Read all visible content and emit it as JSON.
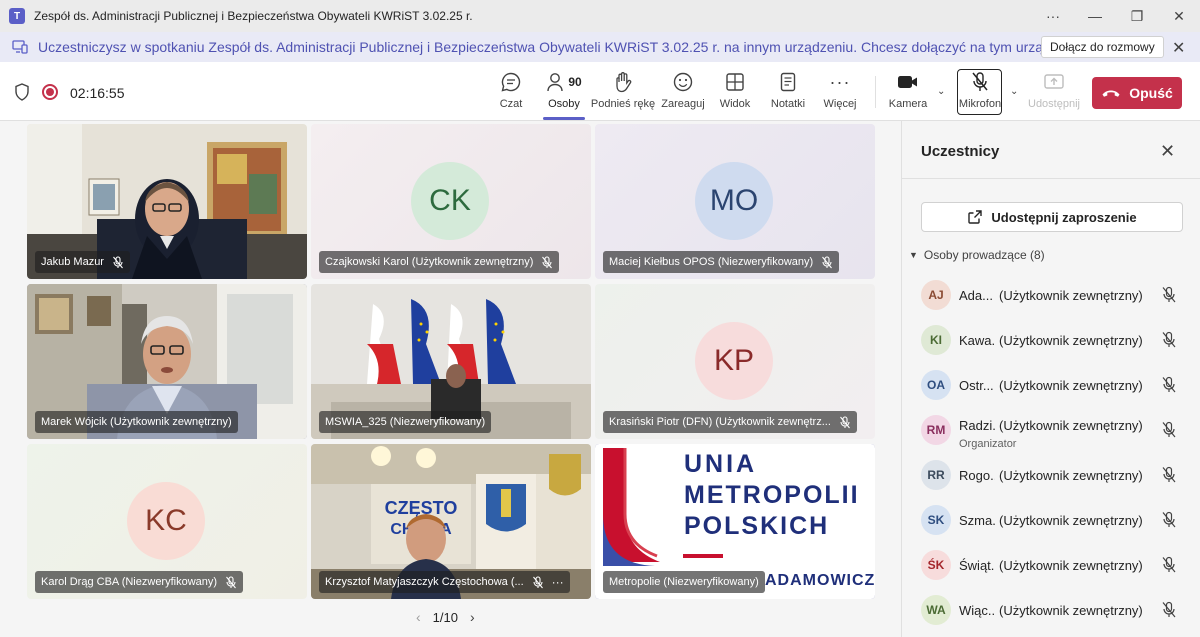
{
  "window": {
    "title": "Zespół ds. Administracji Publicznej i Bezpieczeństwa Obywateli KWRiST 3.02.25 r.",
    "controls": [
      "···",
      "✕",
      "☐",
      "✕"
    ]
  },
  "banner": {
    "message": "Uczestniczysz w spotkaniu Zespół ds. Administracji Publicznej i Bezpieczeństwa Obywateli KWRiST 3.02.25 r. na innym urządzeniu. Chcesz dołączyć na tym urządzeniu?",
    "join_label": "Dołącz do rozmowy"
  },
  "toolbar": {
    "timer": "02:16:55",
    "participants_count": "90",
    "items": {
      "chat": "Czat",
      "people": "Osoby",
      "raise_hand": "Podnieś rękę",
      "react": "Zareaguj",
      "view": "Widok",
      "notes": "Notatki",
      "more": "Więcej",
      "camera": "Kamera",
      "mic": "Mikrofon",
      "share": "Udostępnij"
    },
    "leave_label": "Opuść"
  },
  "tiles": [
    {
      "name": "Jakub Mazur",
      "type": "video"
    },
    {
      "name": "Czajkowski Karol (Użytkownik zewnętrzny)",
      "initials": "CK"
    },
    {
      "name": "Maciej Kiełbus OPOS (Niezweryfikowany)",
      "initials": "MO"
    },
    {
      "name": "Marek Wójcik (Użytkownik zewnętrzny)",
      "type": "video"
    },
    {
      "name": "MSWIA_325 (Niezweryfikowany)",
      "type": "video"
    },
    {
      "name": "Krasiński Piotr (DFN) (Użytkownik zewnętrz...",
      "initials": "KP"
    },
    {
      "name": "Karol Drąg CBA (Niezweryfikowany)",
      "initials": "KC"
    },
    {
      "name": "Krzysztof Matyjaszczyk Częstochowa (...",
      "type": "video"
    },
    {
      "name": "Metropolie (Niezweryfikowany)",
      "type": "video"
    }
  ],
  "metropolie_logo": {
    "line1": "UNIA",
    "line2": "METROPOLII",
    "line3": "POLSKICH",
    "bottom": "ADAMOWICZA"
  },
  "czestochowa_banner": "CZĘSTO\nCHOWA",
  "pager": "1/10",
  "panel": {
    "title": "Uczestnicy",
    "share_label": "Udostępnij zaproszenie",
    "section": "Osoby prowadzące (8)",
    "people": [
      {
        "initials": "AJ",
        "name": "Ada...",
        "ext": "(Użytkownik zewnętrzny)",
        "color": "#f2dcd4",
        "text_color": "#8a4b34"
      },
      {
        "initials": "KI",
        "name": "Kawa...",
        "ext": "(Użytkownik zewnętrzny)",
        "color": "#dfe9d5",
        "text_color": "#4b6b34"
      },
      {
        "initials": "OA",
        "name": "Ostr...",
        "ext": "(Użytkownik zewnętrzny)",
        "color": "#d6e2f2",
        "text_color": "#2f4e80"
      },
      {
        "initials": "RM",
        "name": "Radzi...",
        "ext": "(Użytkownik zewnętrzny)",
        "role": "Organizator",
        "color": "#f2d7e5",
        "text_color": "#8a2f5e"
      },
      {
        "initials": "RR",
        "name": "Rogo...",
        "ext": "(Użytkownik zewnętrzny)",
        "color": "#dde3ea",
        "text_color": "#3b4a5c"
      },
      {
        "initials": "SK",
        "name": "Szma...",
        "ext": "(Użytkownik zewnętrzny)",
        "color": "#d6e2f2",
        "text_color": "#2f4e80"
      },
      {
        "initials": "ŚK",
        "name": "Świąt...",
        "ext": "(Użytkownik zewnętrzny)",
        "color": "#f7dcdc",
        "text_color": "#a4262c"
      },
      {
        "initials": "WA",
        "name": "Wiąc...",
        "ext": "(Użytkownik zewnętrzny)",
        "color": "#e2ecd3",
        "text_color": "#4b6b34"
      }
    ]
  },
  "colors": {
    "accent": "#5b5fc7",
    "leave": "#c4314b",
    "recording": "#c4314b"
  }
}
